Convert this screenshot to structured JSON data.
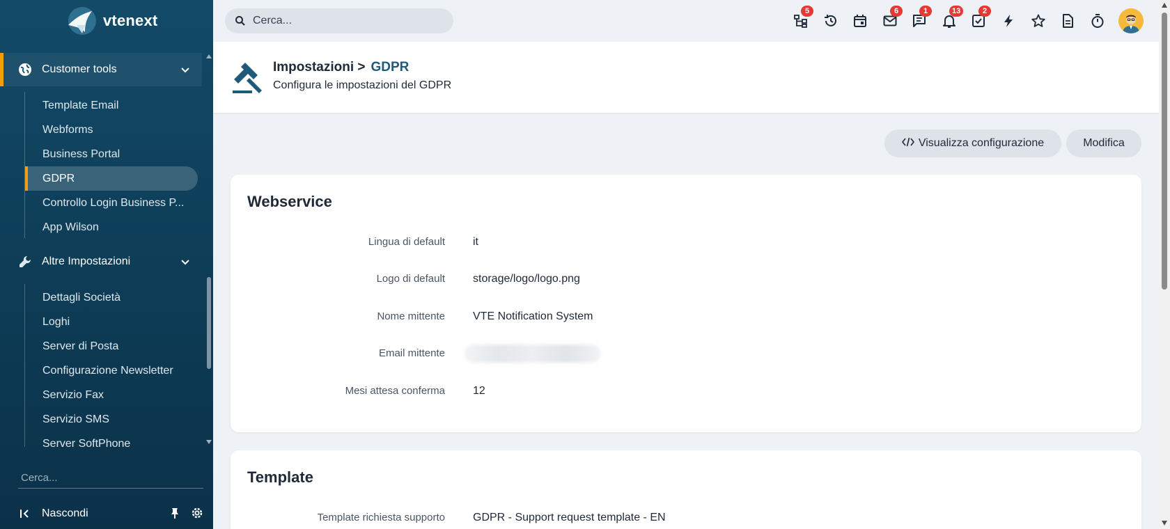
{
  "brand": {
    "name": "vtenext"
  },
  "sidebar": {
    "groups": [
      {
        "label": "Customer tools",
        "items": [
          "Template Email",
          "Webforms",
          "Business Portal",
          "GDPR",
          "Controllo Login Business P...",
          "App Wilson"
        ]
      },
      {
        "label": "Altre Impostazioni",
        "items": [
          "Dettagli Società",
          "Loghi",
          "Server di Posta",
          "Configurazione Newsletter",
          "Servizio Fax",
          "Servizio SMS",
          "Server SoftPhone"
        ]
      }
    ],
    "selected_item": "GDPR",
    "search_placeholder": "Cerca...",
    "footer_label": "Nascondi"
  },
  "topbar": {
    "search_placeholder": "Cerca...",
    "badges": {
      "processes": "5",
      "mail": "6",
      "messages": "1",
      "notifications": "13",
      "tasks": "2"
    }
  },
  "header": {
    "crumb_parent": "Impostazioni >",
    "crumb_current": "GDPR",
    "subtitle": "Configura le impostazioni del GDPR"
  },
  "actions": {
    "view_config": "Visualizza configurazione",
    "edit": "Modifica"
  },
  "webservice": {
    "title": "Webservice",
    "rows": [
      {
        "label": "Lingua di default",
        "value": "it"
      },
      {
        "label": "Logo di default",
        "value": "storage/logo/logo.png"
      },
      {
        "label": "Nome mittente",
        "value": "VTE Notification System"
      },
      {
        "label": "Email mittente",
        "value": ""
      },
      {
        "label": "Mesi attesa conferma",
        "value": "12"
      }
    ]
  },
  "template": {
    "title": "Template",
    "rows": [
      {
        "label": "Template richiesta supporto",
        "value": "GDPR - Support request template - EN"
      }
    ]
  },
  "colors": {
    "sidebar": "#124a68",
    "accent": "#f59e0b",
    "link": "#1e5a7a",
    "badge": "#e53935"
  }
}
